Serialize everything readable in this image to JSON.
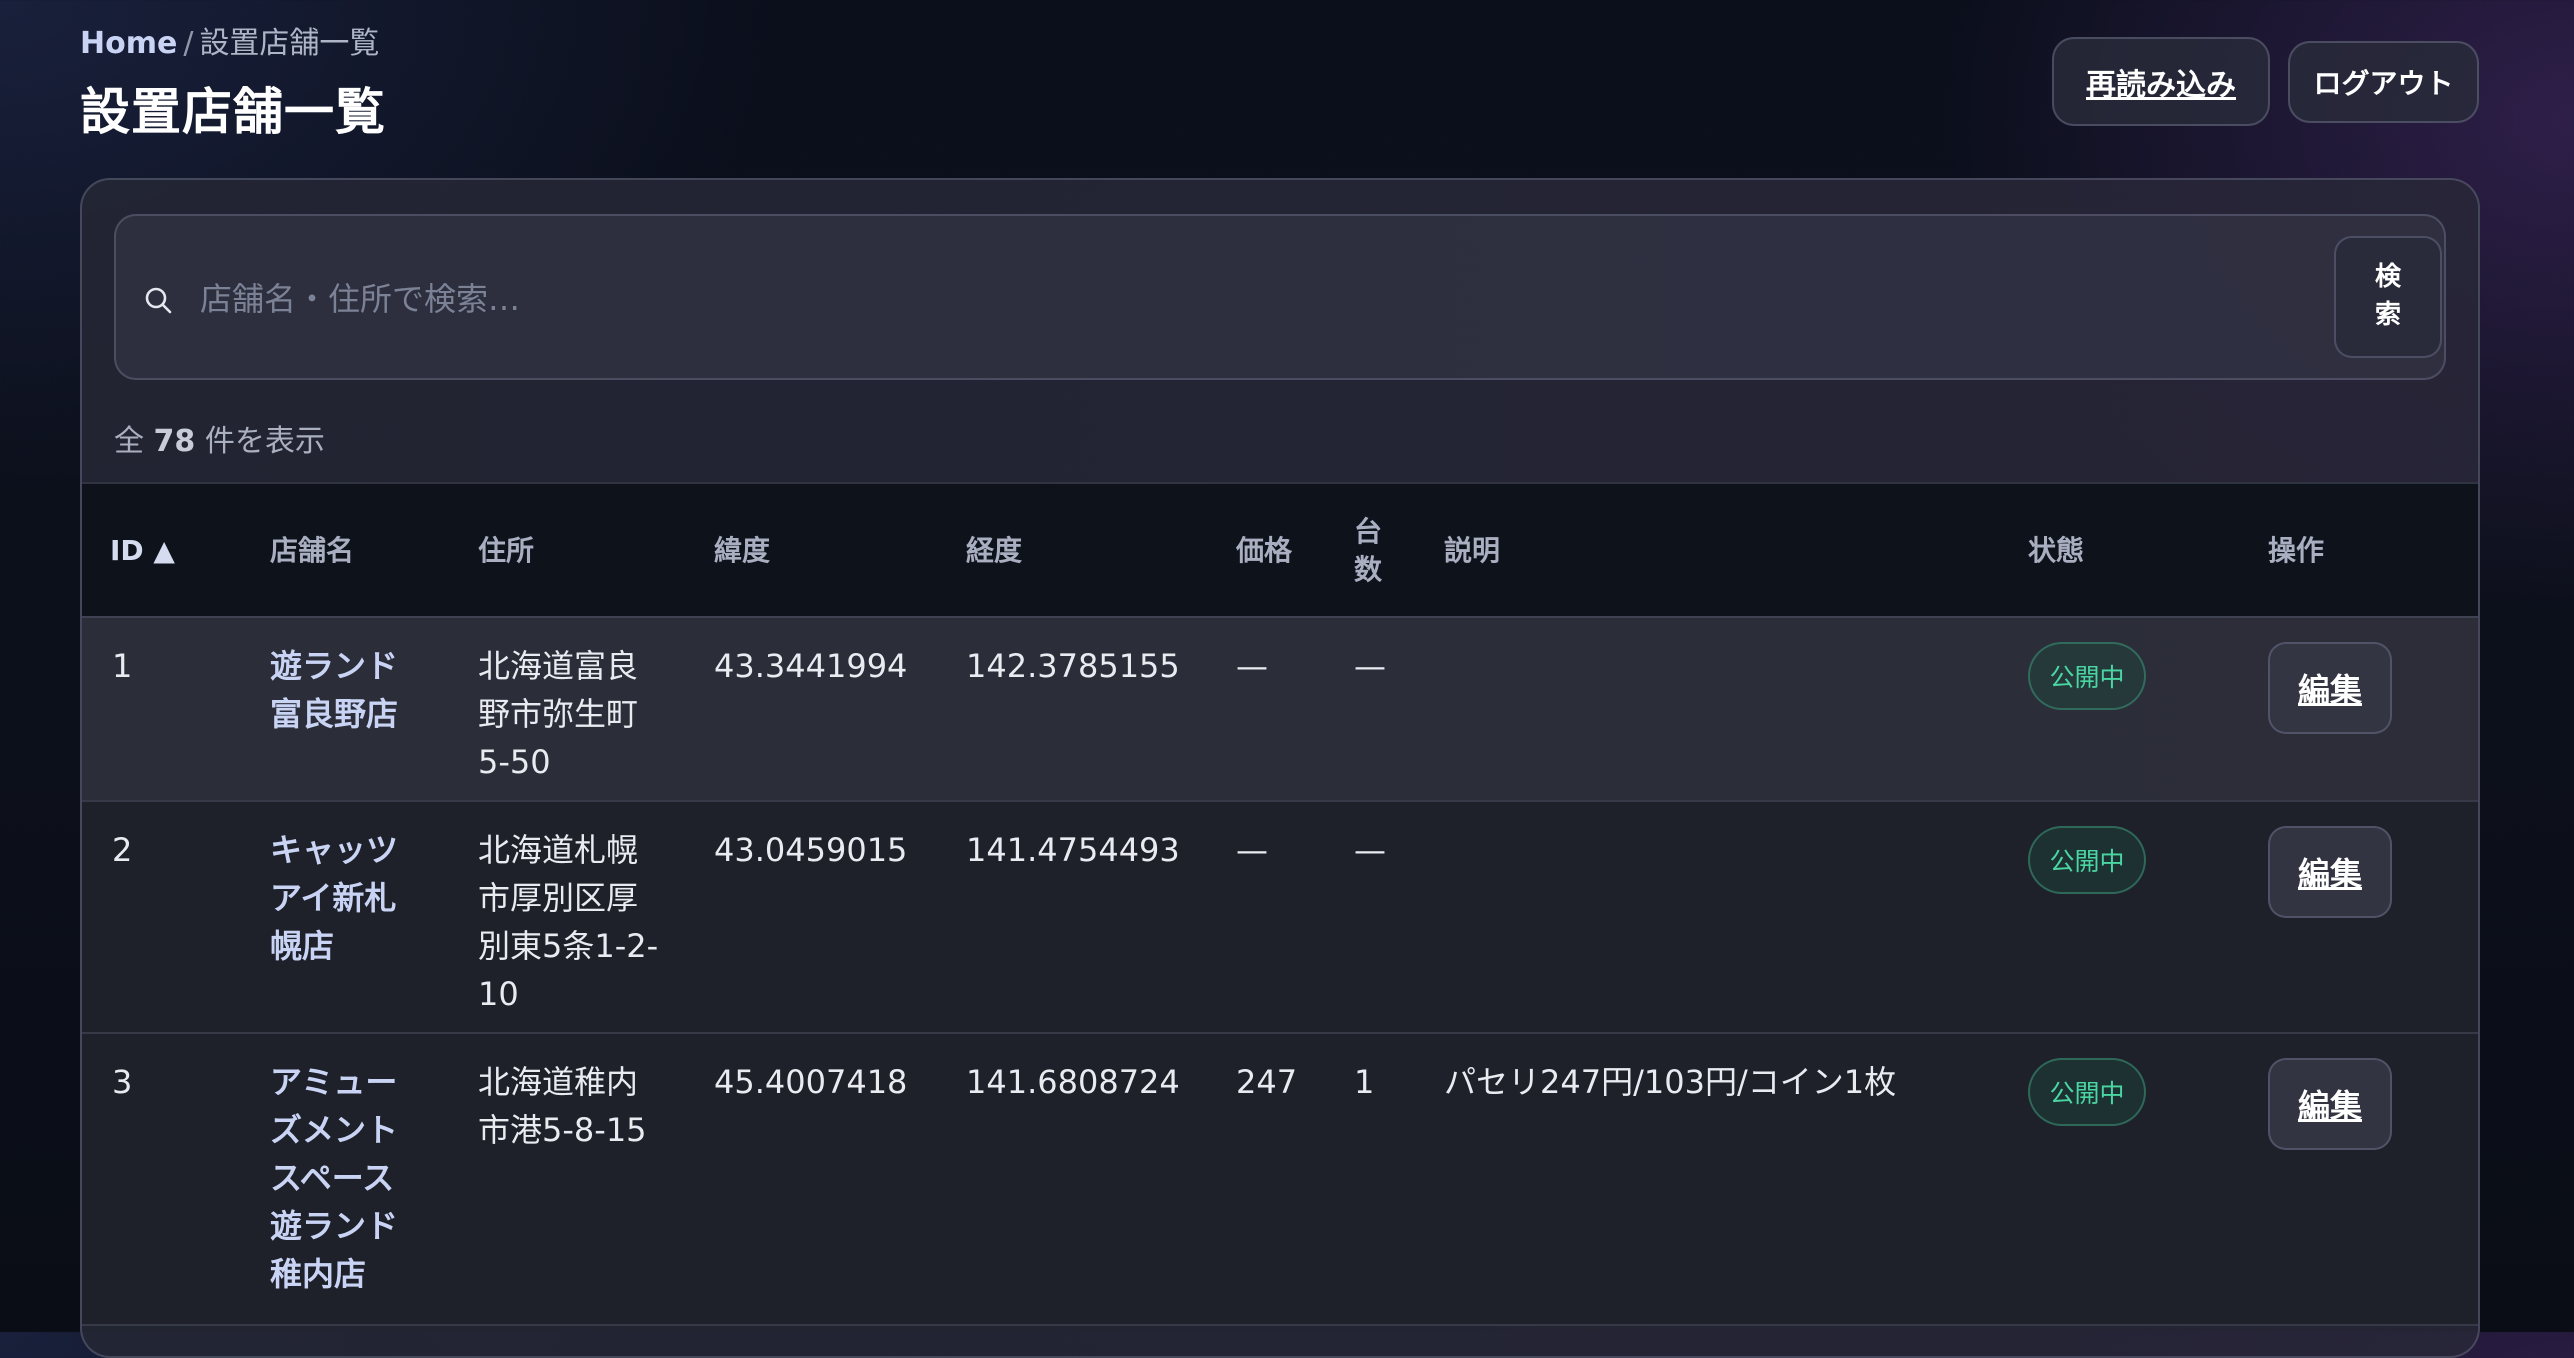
{
  "breadcrumb": {
    "home": "Home",
    "separator": "/",
    "current": "設置店舗一覧"
  },
  "page": {
    "title": "設置店舗一覧"
  },
  "actions": {
    "reload_label": "再読み込み",
    "logout_label": "ログアウト"
  },
  "search": {
    "placeholder": "店舗名・住所で検索…",
    "value": "",
    "button_label": "検\n索",
    "icon": "search-icon"
  },
  "summary": {
    "prefix": "全",
    "count": "78",
    "suffix": "件を表示"
  },
  "table": {
    "columns": {
      "id": "ID",
      "id_sort": "▲",
      "name": "店舗名",
      "address": "住所",
      "lat": "緯度",
      "lng": "経度",
      "price": "価格",
      "units": "台\n数",
      "desc": "説明",
      "status": "状態",
      "ops": "操作"
    },
    "rows": [
      {
        "id": "1",
        "name": "遊ランド\n富良野店",
        "address": "北海道富良\n野市弥生町\n5-50",
        "lat": "43.3441994",
        "lng": "142.3785155",
        "price": "—",
        "units": "—",
        "desc": "",
        "status": "公開中",
        "edit": "編集"
      },
      {
        "id": "2",
        "name": "キャッツ\nアイ新札\n幌店",
        "address": "北海道札幌\n市厚別区厚\n別東5条1-2-\n10",
        "lat": "43.0459015",
        "lng": "141.4754493",
        "price": "—",
        "units": "—",
        "desc": "",
        "status": "公開中",
        "edit": "編集"
      },
      {
        "id": "3",
        "name": "アミュー\nズメント\nスペース\n遊ランド\n稚内店",
        "address": "北海道稚内\n市港5-8-15",
        "lat": "45.4007418",
        "lng": "141.6808724",
        "price": "247",
        "units": "1",
        "desc": "パセリ247円/103円/コイン1枚",
        "status": "公開中",
        "edit": "編集"
      }
    ]
  },
  "colors": {
    "accent_link": "#c9d4f5",
    "status_green": "#49d6a2",
    "background": "#0b0f1c"
  }
}
